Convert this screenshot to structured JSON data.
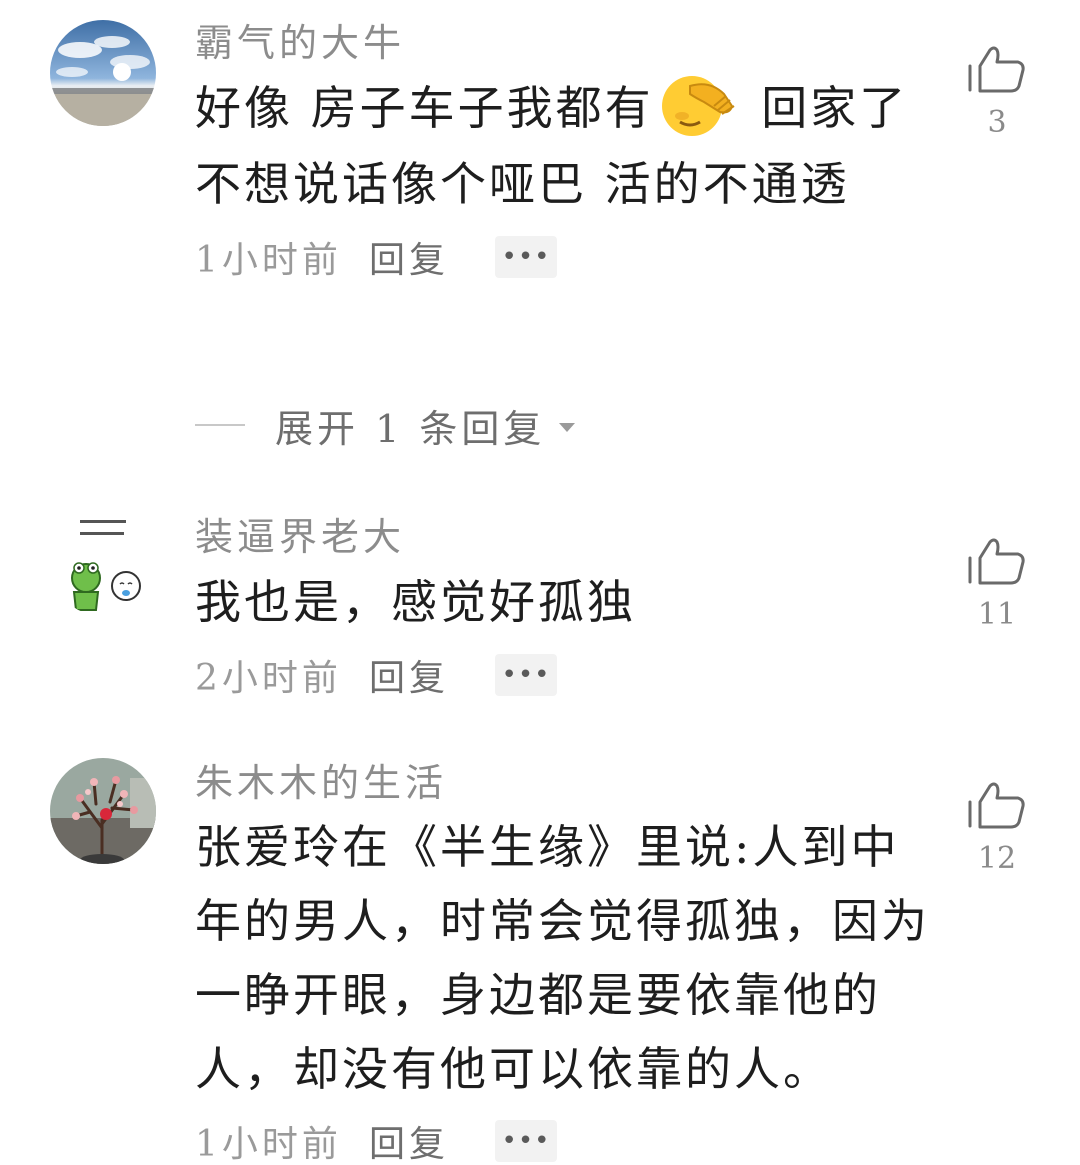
{
  "comments": [
    {
      "username": "霸气的大牛",
      "avatar_icon": "sky-landscape-avatar-icon",
      "text_before_emoji": "好像 房子车子我都有",
      "emoji_icon": "facepalm-emoji-icon",
      "text_after_emoji": " 回家了不想说话像个哑巴 活的不通透",
      "time": "1小时前",
      "reply_label": "回复",
      "more_label": "•••",
      "like_count": "3",
      "expand_replies_label": "展开 1 条回复"
    },
    {
      "username": "装逼界老大",
      "avatar_icon": "frog-cartoon-avatar-icon",
      "text": "我也是，感觉好孤独",
      "time": "2小时前",
      "reply_label": "回复",
      "more_label": "•••",
      "like_count": "11"
    },
    {
      "username": "朱木木的生活",
      "avatar_icon": "plum-blossom-avatar-icon",
      "text": "张爱玲在《半生缘》里说:人到中年的男人，时常会觉得孤独，因为一睁开眼，身边都是要依靠他的人，却没有他可以依靠的人。",
      "time": "1小时前",
      "reply_label": "回复",
      "more_label": "•••",
      "like_count": "12"
    }
  ],
  "colors": {
    "username": "#8c8c8c",
    "text": "#1e1e1e",
    "meta": "#9a9a9a",
    "more_bg": "#f2f2f2"
  }
}
